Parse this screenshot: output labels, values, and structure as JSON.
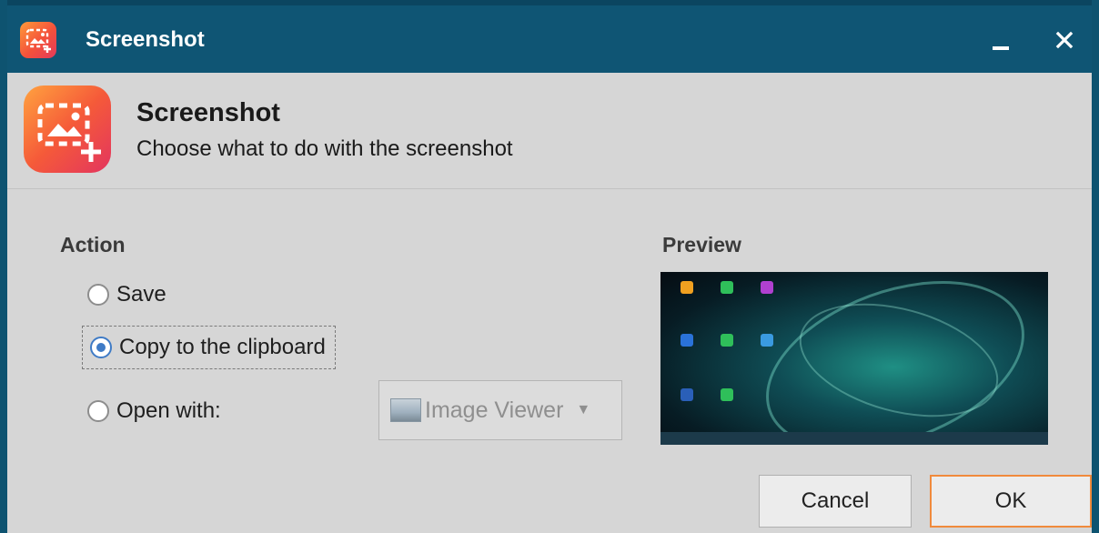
{
  "window": {
    "title": "Screenshot",
    "app_icon": "screenshot-app-icon",
    "title_color": "#0f5574",
    "minimize_icon": "minimize-icon",
    "close_icon": "close-icon"
  },
  "header": {
    "title": "Screenshot",
    "subtitle": "Choose what to do with the screenshot",
    "icon": "screenshot-app-icon"
  },
  "action": {
    "label": "Action",
    "options": [
      {
        "label": "Save",
        "checked": false
      },
      {
        "label": "Copy to the clipboard",
        "checked": true
      },
      {
        "label": "Open with:",
        "checked": false
      }
    ],
    "open_with": {
      "selected": "Image Viewer",
      "icon": "image-viewer-icon",
      "enabled": false
    }
  },
  "preview": {
    "label": "Preview"
  },
  "buttons": {
    "cancel": "Cancel",
    "ok": "OK"
  },
  "colors": {
    "accent": "#3f7bc6",
    "default_button_border": "#f08a3c",
    "app_icon_gradient": [
      "#ffa23f",
      "#f55a39",
      "#e3355f"
    ]
  }
}
